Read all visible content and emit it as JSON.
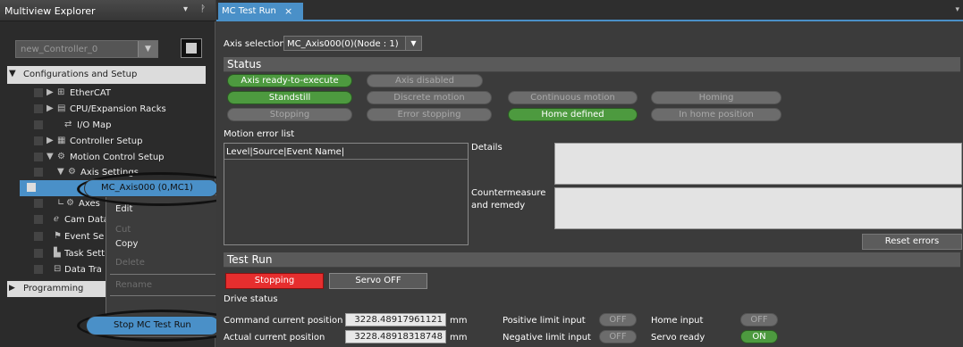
{
  "left_pane": {
    "title": "Multiview Explorer",
    "pin_icons": "▾ ⊓",
    "controller": "new_Controller_0",
    "tree": {
      "configurations": "Configurations and Setup",
      "ethercat": "EtherCAT",
      "cpu_racks": "CPU/Expansion Racks",
      "io_map": "I/O Map",
      "controller_setup": "Controller Setup",
      "motion_control_setup": "Motion Control Setup",
      "axis_settings": "Axis Settings",
      "selected_axis": "MC_Axis000 (0,MC1)",
      "axes": "Axes",
      "cam_data": "Cam Data",
      "event_settings": "Event Se",
      "task_settings": "Task Setti",
      "data_trace": "Data Tra",
      "programming": "Programming"
    },
    "context_menu": {
      "edit": "Edit",
      "cut": "Cut",
      "copy": "Copy",
      "delete": "Delete",
      "rename": "Rename",
      "stop_mc_test_run": "Stop MC Test Run"
    }
  },
  "tab": {
    "label": "MC Test Run",
    "close": "×"
  },
  "axis_selection": {
    "label": "Axis selection",
    "value": "MC_Axis000(0)(Node : 1)"
  },
  "status": {
    "title": "Status",
    "pills": [
      {
        "label": "Axis ready-to-execute",
        "on": true
      },
      {
        "label": "Axis disabled",
        "on": false
      },
      {
        "label": "Standstill",
        "on": true
      },
      {
        "label": "Discrete motion",
        "on": false
      },
      {
        "label": "Continuous motion",
        "on": false
      },
      {
        "label": "Homing",
        "on": false
      },
      {
        "label": "Stopping",
        "on": false
      },
      {
        "label": "Error stopping",
        "on": false
      },
      {
        "label": "Home defined",
        "on": true
      },
      {
        "label": "In home position",
        "on": false
      }
    ]
  },
  "motion_error": {
    "title": "Motion error list",
    "header": "Level|Source|Event Name|",
    "details_label": "Details",
    "remedy_label": "Countermeasure and remedy",
    "reset_button": "Reset errors"
  },
  "test_run": {
    "title": "Test Run",
    "stopping_button": "Stopping",
    "servo_off_button": "Servo OFF",
    "drive_status": "Drive status",
    "command_position_label": "Command current position",
    "command_position_value": "3228.48917961121",
    "actual_position_label": "Actual current position",
    "actual_position_value": "3228.48918318748",
    "unit": "mm",
    "positive_limit_label": "Positive limit input",
    "positive_limit_value": "OFF",
    "negative_limit_label": "Negative limit input",
    "negative_limit_value": "OFF",
    "home_input_label": "Home input",
    "home_input_value": "OFF",
    "servo_ready_label": "Servo ready",
    "servo_ready_value": "ON"
  }
}
